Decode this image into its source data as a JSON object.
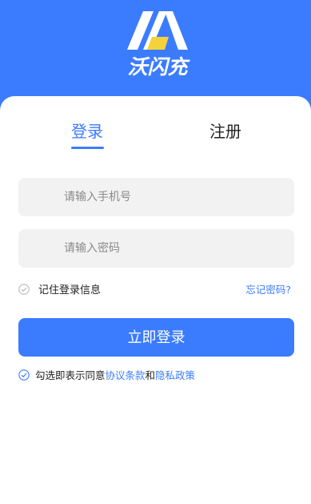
{
  "brand": {
    "name": "沃闪充",
    "primary_color": "#3b7cff",
    "accent_color": "#f6d23a"
  },
  "tabs": {
    "login": "登录",
    "register": "注册",
    "active": "login"
  },
  "form": {
    "phone_placeholder": "请输入手机号",
    "password_placeholder": "请输入密码",
    "remember_label": "记住登录信息",
    "forgot_label": "忘记密码?",
    "submit_label": "立即登录"
  },
  "agreement": {
    "prefix": "勾选即表示同意",
    "terms": "协议条款",
    "joiner": "和",
    "privacy": "隐私政策"
  },
  "icons": {
    "remember": "check-circle-icon",
    "agreement": "check-circle-icon",
    "logo": "wo-flash-logo"
  }
}
